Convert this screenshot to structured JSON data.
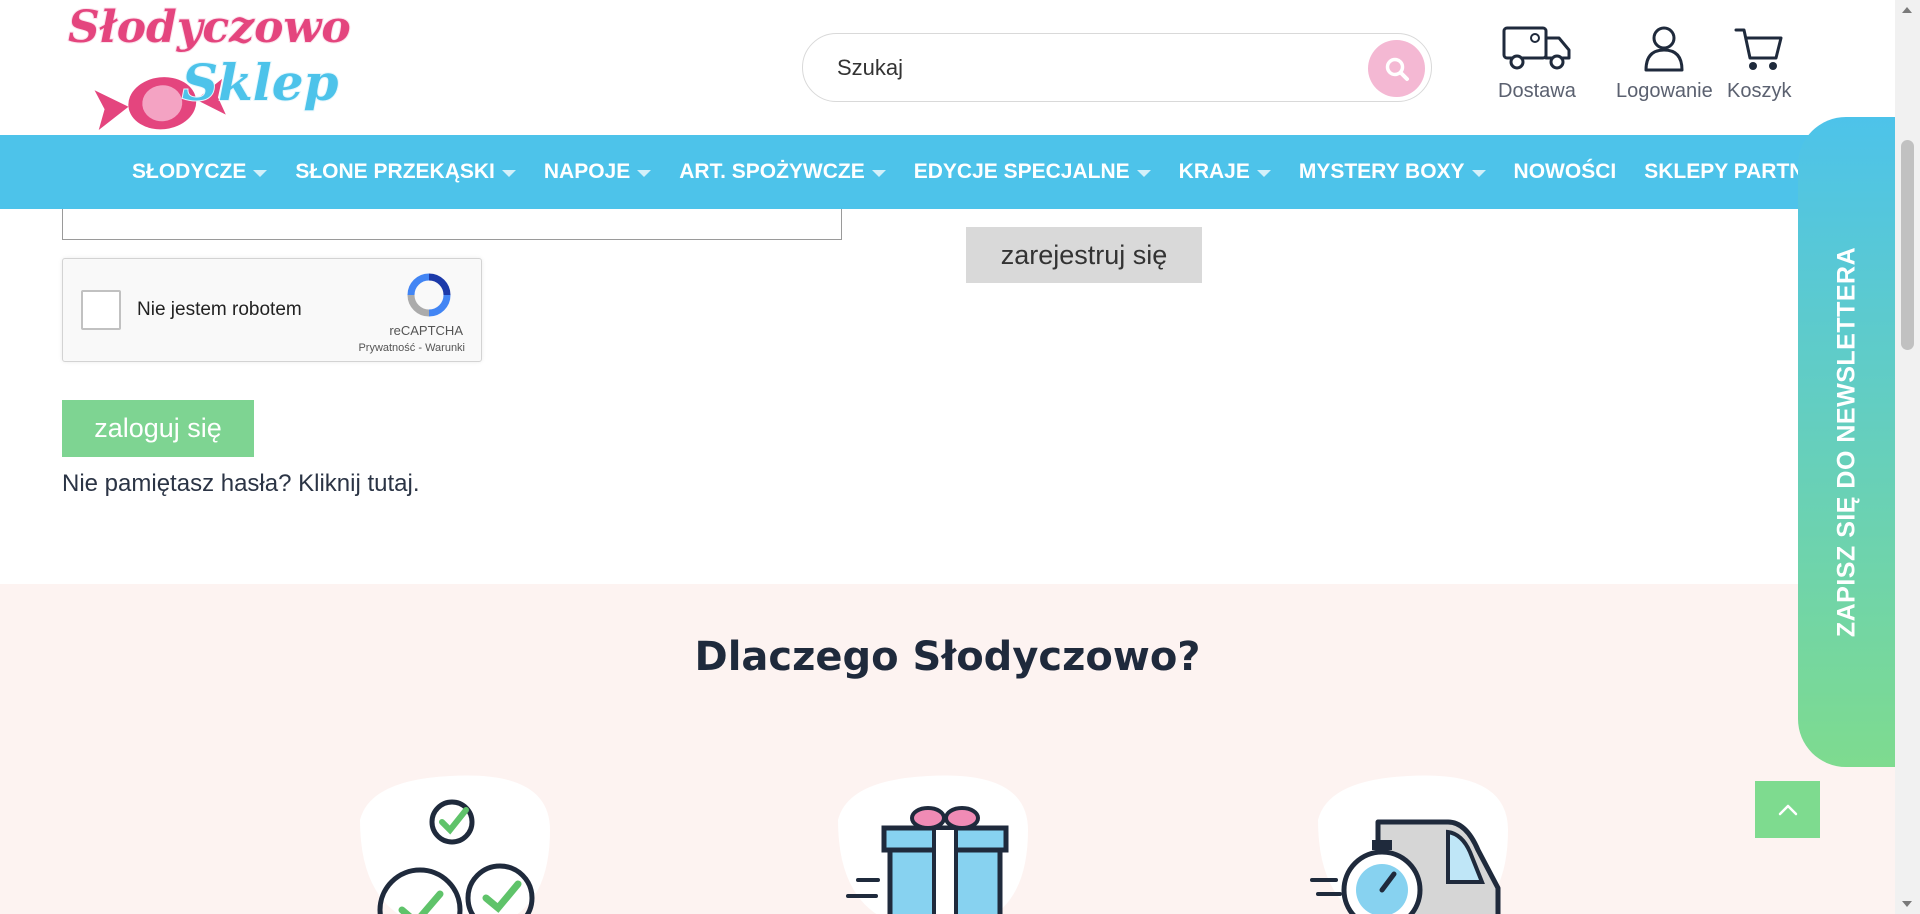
{
  "header": {
    "logo_text_line1": "Słodyczowo",
    "logo_text_line2": "Sklep",
    "search_placeholder": "Szukaj",
    "links": {
      "delivery": "Dostawa",
      "login": "Logowanie",
      "cart": "Koszyk"
    }
  },
  "nav": {
    "items": [
      {
        "label": "SŁODYCZE",
        "dropdown": true
      },
      {
        "label": "SŁONE PRZEKĄSKI",
        "dropdown": true
      },
      {
        "label": "NAPOJE",
        "dropdown": true
      },
      {
        "label": "ART. SPOŻYWCZE",
        "dropdown": true
      },
      {
        "label": "EDYCJE SPECJALNE",
        "dropdown": true
      },
      {
        "label": "KRAJE",
        "dropdown": true
      },
      {
        "label": "MYSTERY BOXY",
        "dropdown": true
      },
      {
        "label": "NOWOŚCI",
        "dropdown": false
      },
      {
        "label": "SKLEPY PARTNERSKIE",
        "dropdown": true
      }
    ]
  },
  "login": {
    "password_mask": "••••••••••",
    "recaptcha_label": "Nie jestem robotem",
    "recaptcha_brand": "reCAPTCHA",
    "recaptcha_links": "Prywatność - Warunki",
    "login_button": "zaloguj się",
    "forgot_text": "Nie pamiętasz hasła? Kliknij tutaj."
  },
  "register": {
    "button": "zarejestruj się"
  },
  "why": {
    "title": "Dlaczego Słodyczowo?"
  },
  "newsletter": {
    "label": "ZAPISZ SIĘ DO NEWSLETTERA"
  },
  "colors": {
    "nav_bg": "#4dc3ea",
    "accent_green": "#7ed492",
    "pink": "#e4457e",
    "section_bg": "#fdf3f1"
  }
}
